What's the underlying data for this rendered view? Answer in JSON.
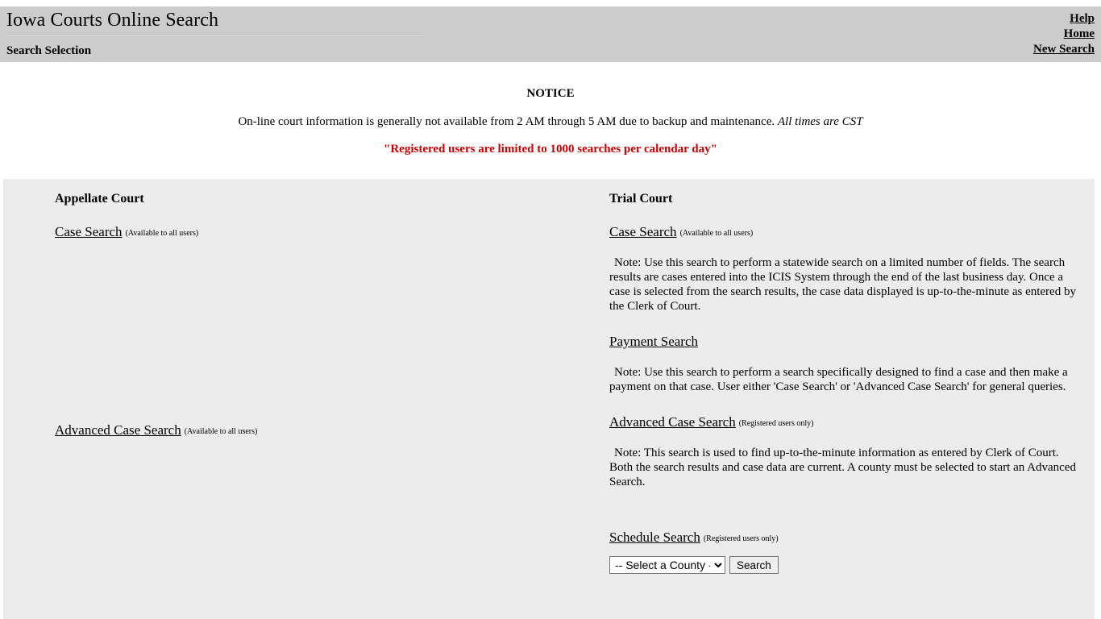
{
  "header": {
    "site_title": "Iowa Courts Online Search",
    "section_label": "Search Selection",
    "nav": [
      {
        "label": "Help",
        "name": "help-link"
      },
      {
        "label": "Home",
        "name": "home-link"
      },
      {
        "label": "New Search",
        "name": "new-search-link"
      }
    ]
  },
  "notice": {
    "heading": "NOTICE",
    "text_main": "On-line court information is generally not available from 2 AM through 5 AM due to backup and maintenance.",
    "text_italic": "All times are CST",
    "warning": "\"Registered users are limited to 1000 searches per calendar day\""
  },
  "appellate_court": {
    "heading": "Appellate Court",
    "case_search": {
      "link": "Case Search",
      "qualifier": "(Available to all users)"
    },
    "advanced_case_search": {
      "link": "Advanced Case Search",
      "qualifier": "(Available to all users)"
    }
  },
  "trial_court": {
    "heading": "Trial Court",
    "case_search": {
      "link": "Case Search",
      "qualifier": "(Available to all users)",
      "note": "Note:  Use this search to perform a statewide search on a limited number of fields. The search results are cases entered into the ICIS System through the end of the last business day. Once a case is selected from the search results, the case data displayed is up-to-the-minute as entered by the Clerk of Court."
    },
    "payment_search": {
      "link": "Payment Search",
      "qualifier": "",
      "note": "Note:  Use this search to perform a search specifically designed to find a case and then make a payment on that case. User either 'Case Search' or 'Advanced Case Search' for general queries."
    },
    "advanced_case_search": {
      "link": "Advanced Case Search",
      "qualifier": "(Registered users only)",
      "note": "Note:  This search is used to find up-to-the-minute information as entered by Clerk of Court. Both the search results and case data are current. A county must be selected to start an Advanced Search."
    },
    "schedule_search": {
      "link": "Schedule Search",
      "qualifier": "(Registered users only)",
      "county_select_value": "-- Select a County --",
      "search_button": "Search"
    }
  },
  "colors": {
    "header_band": "#cccccc",
    "content_panel": "#ececec",
    "warning_red": "#cc0000"
  }
}
